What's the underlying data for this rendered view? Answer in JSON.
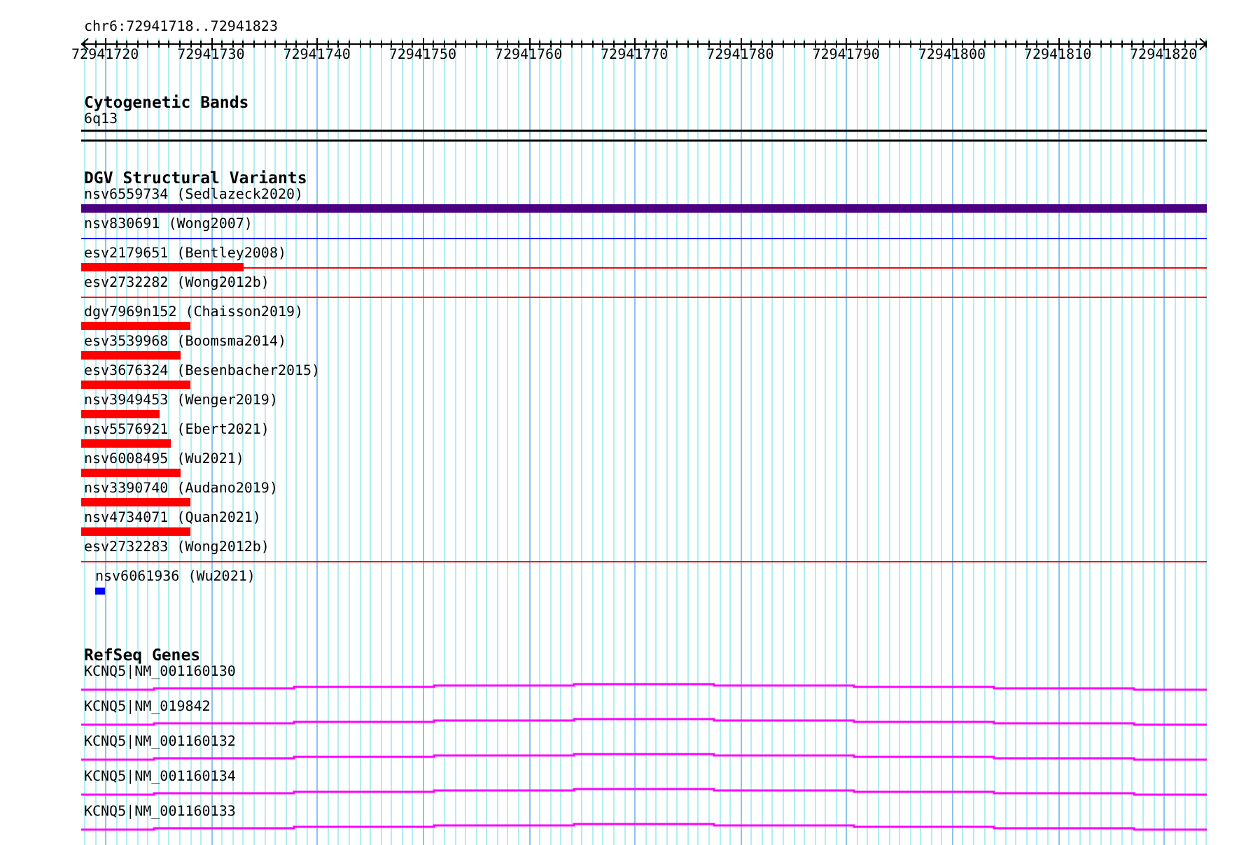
{
  "location": "chr6:72941718..72941823",
  "ruler": {
    "labels": [
      "72941720",
      "72941730",
      "72941740",
      "72941750",
      "72941760",
      "72941770",
      "72941780",
      "72941790",
      "72941800",
      "72941810",
      "72941820"
    ]
  },
  "tracks": [
    {
      "kind": "cytoband",
      "title": "Cytogenetic Bands",
      "features": [
        {
          "label": "6q13"
        }
      ]
    },
    {
      "kind": "variants",
      "title": "DGV Structural Variants",
      "features": [
        {
          "label": "nsv6559734 (Sedlazeck2020)",
          "kind": "bar",
          "color": "#4b0082",
          "level": 1
        },
        {
          "label": "nsv830691 (Wong2007)",
          "kind": "line",
          "color": "#0000ff"
        },
        {
          "label": "esv2179651 (Bentley2008)",
          "kind": "bar-line",
          "color": "#ff0000",
          "level": 0.144
        },
        {
          "label": "esv2732282 (Wong2012b)",
          "kind": "line",
          "color": "#ff0000"
        },
        {
          "label": "dgv7969n152 (Chaisson2019)",
          "kind": "bar",
          "color": "#ff0000",
          "level": 0.097
        },
        {
          "label": "esv3539968 (Boomsma2014)",
          "kind": "bar",
          "color": "#ff0000",
          "level": 0.088
        },
        {
          "label": "esv3676324 (Besenbacher2015)",
          "kind": "bar",
          "color": "#ff0000",
          "level": 0.097
        },
        {
          "label": "nsv3949453 (Wenger2019)",
          "kind": "bar",
          "color": "#ff0000",
          "level": 0.07
        },
        {
          "label": "nsv5576921 (Ebert2021)",
          "kind": "bar",
          "color": "#ff0000",
          "level": 0.08
        },
        {
          "label": "nsv6008495 (Wu2021)",
          "kind": "bar",
          "color": "#ff0000",
          "level": 0.088
        },
        {
          "label": "nsv3390740 (Audano2019)",
          "kind": "bar",
          "color": "#ff0000",
          "level": 0.097
        },
        {
          "label": "nsv4734071 (Quan2021)",
          "kind": "bar",
          "color": "#ff0000",
          "level": 0.097
        },
        {
          "label": "esv2732283 (Wong2012b)",
          "kind": "line",
          "color": "#ff0000"
        },
        {
          "label": "nsv6061936 (Wu2021)",
          "kind": "block",
          "color": "#0000ff"
        }
      ]
    },
    {
      "kind": "genes",
      "title": "RefSeq Genes",
      "features": [
        {
          "label": "KCNQ5|NM_001160130"
        },
        {
          "label": "KCNQ5|NM_019842"
        },
        {
          "label": "KCNQ5|NM_001160132"
        },
        {
          "label": "KCNQ5|NM_001160134"
        },
        {
          "label": "KCNQ5|NM_001160133"
        }
      ]
    }
  ]
}
